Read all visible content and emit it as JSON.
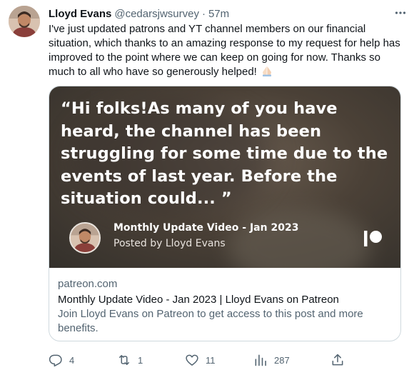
{
  "tweet": {
    "author_name": "Lloyd Evans",
    "author_handle": "@cedarsjwsurvey",
    "separator": "·",
    "time": "57m",
    "text": "I've just updated patrons and YT channel members on our financial situation, which thanks to an amazing response to my request for help has improved to the point where we can keep on going for now. Thanks so much to all who have so generously helped!",
    "emoji": "folded-hands"
  },
  "card": {
    "quote": "“Hi folks!As many of you have heard, the channel has been struggling for some time due to the events of last year. Before the situation could... ”",
    "post_title": "Monthly Update Video - Jan 2023",
    "post_author": "Posted by Lloyd Evans",
    "domain": "patreon.com",
    "title": "Monthly Update Video - Jan 2023 | Lloyd Evans on Patreon",
    "description": "Join Lloyd Evans on Patreon to get access to this post and more benefits."
  },
  "actions": {
    "replies": "4",
    "retweets": "1",
    "likes": "11",
    "views": "287"
  },
  "icons": {
    "more": "more-horizontal-icon",
    "reply": "reply-icon",
    "retweet": "retweet-icon",
    "like": "heart-icon",
    "views": "views-chart-icon",
    "share": "share-icon",
    "patreon": "patreon-logo"
  },
  "colors": {
    "text": "#0f1419",
    "secondary": "#536471",
    "border": "#cfd9de",
    "card_bg": "#4b4137"
  }
}
